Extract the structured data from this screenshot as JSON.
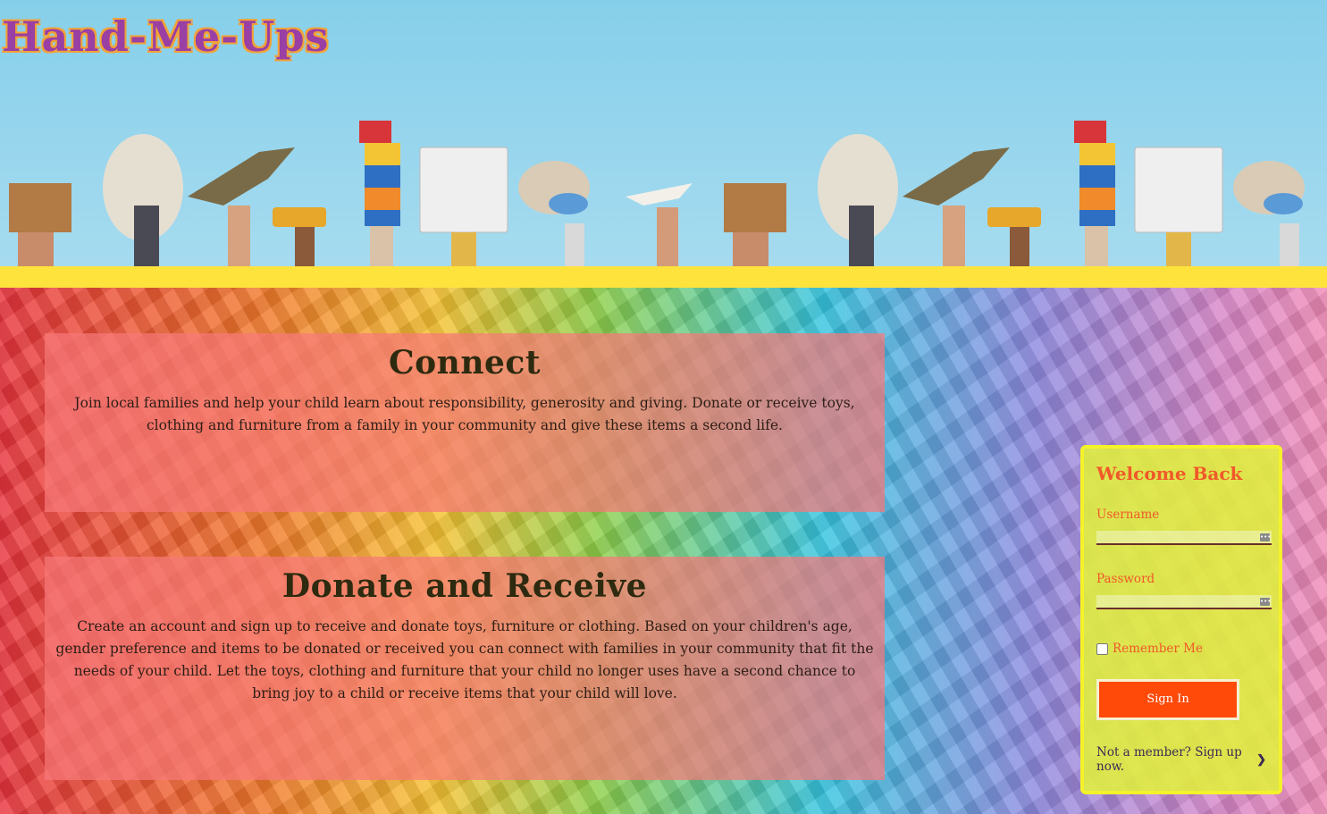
{
  "header": {
    "logo": "Hand-Me-Ups"
  },
  "sections": [
    {
      "title": "Connect",
      "body": "Join local families and help your child learn about responsibility, generosity and giving. Donate or receive toys, clothing and furniture from a family in your community and give these items a second life."
    },
    {
      "title": "Donate and Receive",
      "body": "Create an account and sign up to receive and donate toys, furniture or clothing. Based on your children's age, gender preference and items to be donated or received you can connect with families in your community that fit the needs of your child. Let the toys, clothing and furniture that your child no longer uses have a second chance to bring joy to a child or receive items that your child will love."
    }
  ],
  "login": {
    "title": "Welcome Back",
    "username_label": "Username",
    "username_value": "",
    "password_label": "Password",
    "password_value": "",
    "remember_label": "Remember Me",
    "remember_checked": false,
    "signin_label": "Sign In",
    "signup_text": "Not a member? Sign up now.",
    "signup_icon": "chevron-right-icon"
  },
  "colors": {
    "accent_orange": "#f0582a",
    "signin_button": "#ff4a0a",
    "header_band": "#ffe33d",
    "card_background": "#f77878",
    "logo_purple": "#9a3fa3"
  }
}
